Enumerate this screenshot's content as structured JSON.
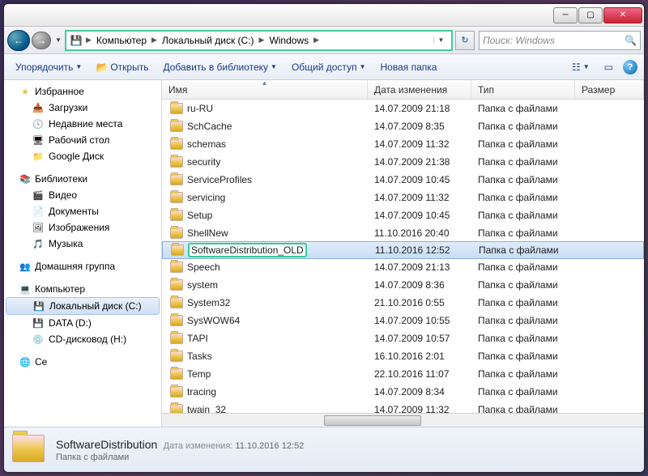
{
  "breadcrumb": {
    "items": [
      "Компьютер",
      "Локальный диск (C:)",
      "Windows"
    ]
  },
  "search": {
    "placeholder": "Поиск: Windows"
  },
  "toolbar": {
    "organize": "Упорядочить",
    "open": "Открыть",
    "add_library": "Добавить в библиотеку",
    "share": "Общий доступ",
    "new_folder": "Новая папка"
  },
  "columns": {
    "name": "Имя",
    "date": "Дата изменения",
    "type": "Тип",
    "size": "Размер"
  },
  "sidebar": {
    "favorites": {
      "label": "Избранное",
      "items": [
        {
          "icon": "download",
          "label": "Загрузки"
        },
        {
          "icon": "recent",
          "label": "Недавние места"
        },
        {
          "icon": "desktop",
          "label": "Рабочий стол"
        },
        {
          "icon": "gdrive",
          "label": "Google Диск"
        }
      ]
    },
    "libraries": {
      "label": "Библиотеки",
      "items": [
        {
          "icon": "video",
          "label": "Видео"
        },
        {
          "icon": "documents",
          "label": "Документы"
        },
        {
          "icon": "pictures",
          "label": "Изображения"
        },
        {
          "icon": "music",
          "label": "Музыка"
        }
      ]
    },
    "homegroup": {
      "label": "Домашняя группа"
    },
    "computer": {
      "label": "Компьютер",
      "items": [
        {
          "icon": "drive",
          "label": "Локальный диск (C:)",
          "selected": true
        },
        {
          "icon": "drive",
          "label": "DATA (D:)"
        },
        {
          "icon": "cd",
          "label": "CD-дисковод (H:)"
        }
      ]
    },
    "net": {
      "label": "Се"
    }
  },
  "files": [
    {
      "name": "ru-RU",
      "date": "14.07.2009 21:18",
      "type": "Папка с файлами"
    },
    {
      "name": "SchCache",
      "date": "14.07.2009 8:35",
      "type": "Папка с файлами"
    },
    {
      "name": "schemas",
      "date": "14.07.2009 11:32",
      "type": "Папка с файлами"
    },
    {
      "name": "security",
      "date": "14.07.2009 21:38",
      "type": "Папка с файлами"
    },
    {
      "name": "ServiceProfiles",
      "date": "14.07.2009 10:45",
      "type": "Папка с файлами"
    },
    {
      "name": "servicing",
      "date": "14.07.2009 11:32",
      "type": "Папка с файлами"
    },
    {
      "name": "Setup",
      "date": "14.07.2009 10:45",
      "type": "Папка с файлами"
    },
    {
      "name": "ShellNew",
      "date": "11.10.2016 20:40",
      "type": "Папка с файлами"
    },
    {
      "name": "SoftwareDistribution_OLD",
      "date": "11.10.2016 12:52",
      "type": "Папка с файлами",
      "selected": true,
      "highlight": true
    },
    {
      "name": "Speech",
      "date": "14.07.2009 21:13",
      "type": "Папка с файлами"
    },
    {
      "name": "system",
      "date": "14.07.2009 8:36",
      "type": "Папка с файлами"
    },
    {
      "name": "System32",
      "date": "21.10.2016 0:55",
      "type": "Папка с файлами"
    },
    {
      "name": "SysWOW64",
      "date": "14.07.2009 10:55",
      "type": "Папка с файлами"
    },
    {
      "name": "TAPI",
      "date": "14.07.2009 10:57",
      "type": "Папка с файлами"
    },
    {
      "name": "Tasks",
      "date": "16.10.2016 2:01",
      "type": "Папка с файлами"
    },
    {
      "name": "Temp",
      "date": "22.10.2016 11:07",
      "type": "Папка с файлами"
    },
    {
      "name": "tracing",
      "date": "14.07.2009 8:34",
      "type": "Папка с файлами"
    },
    {
      "name": "twain_32",
      "date": "14.07.2009 11:32",
      "type": "Папка с файлами"
    }
  ],
  "details": {
    "title": "SoftwareDistribution",
    "subtitle": "Папка с файлами",
    "date_label": "Дата изменения:",
    "date_value": "11.10.2016 12:52"
  }
}
